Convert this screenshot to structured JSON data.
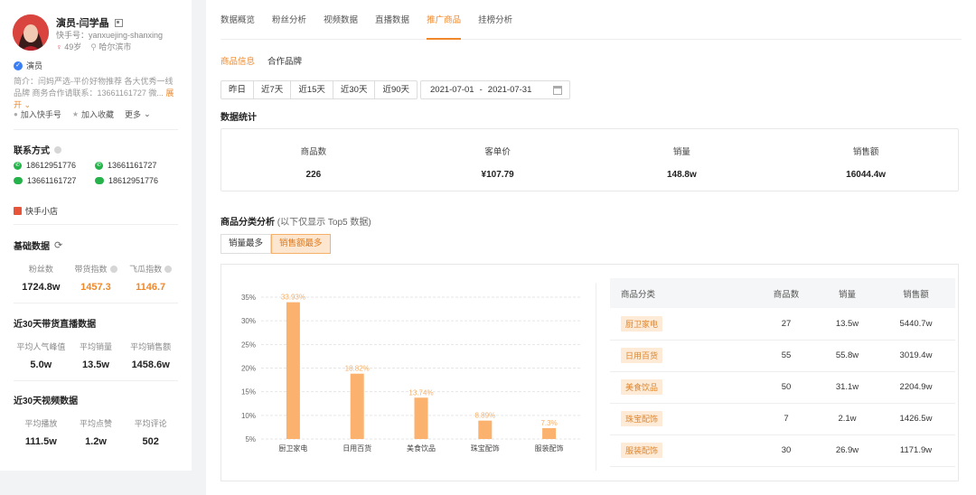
{
  "profile": {
    "name": "演员-闫学晶",
    "kuaishou_id": "快手号：yanxuejing-shanxing",
    "age": "49岁",
    "city": "哈尔滨市",
    "role": "演员",
    "intro": "简介：闫妈严选-平价好物推荐 各大优秀一线品牌 商务合作请联系：13661161727 微...",
    "expand": "展开",
    "actions": {
      "add_kuaishou": "加入快手号",
      "add_favorite": "加入收藏",
      "more": "更多"
    }
  },
  "contact": {
    "title": "联系方式",
    "items": [
      {
        "type": "phone",
        "value": "18612951776"
      },
      {
        "type": "phone",
        "value": "13661161727"
      },
      {
        "type": "wechat",
        "value": "13661161727"
      },
      {
        "type": "wechat",
        "value": "18612951776"
      }
    ],
    "shop": "快手小店"
  },
  "basic": {
    "title": "基础数据",
    "stats": [
      {
        "label": "粉丝数",
        "value": "1724.8w"
      },
      {
        "label": "带货指数",
        "value": "1457.3"
      },
      {
        "label": "飞瓜指数",
        "value": "1146.7"
      }
    ]
  },
  "live30": {
    "title": "近30天带货直播数据",
    "stats": [
      {
        "label": "平均人气峰值",
        "value": "5.0w"
      },
      {
        "label": "平均销量",
        "value": "13.5w"
      },
      {
        "label": "平均销售额",
        "value": "1458.6w"
      }
    ]
  },
  "video30": {
    "title": "近30天视频数据",
    "stats": [
      {
        "label": "平均播放",
        "value": "111.5w"
      },
      {
        "label": "平均点赞",
        "value": "1.2w"
      },
      {
        "label": "平均评论",
        "value": "502"
      }
    ]
  },
  "tabs": [
    "数据概览",
    "粉丝分析",
    "视频数据",
    "直播数据",
    "推广商品",
    "挂榜分析"
  ],
  "active_tab": "推广商品",
  "subtabs": [
    "商品信息",
    "合作品牌"
  ],
  "ranges": [
    "昨日",
    "近7天",
    "近15天",
    "近30天",
    "近90天"
  ],
  "date": {
    "start": "2021-07-01",
    "sep": "-",
    "end": "2021-07-31"
  },
  "summary": {
    "title": "数据统计",
    "items": [
      {
        "label": "商品数",
        "value": "226"
      },
      {
        "label": "客单价",
        "value": "¥107.79"
      },
      {
        "label": "销量",
        "value": "148.8w"
      },
      {
        "label": "销售额",
        "value": "16044.4w"
      }
    ]
  },
  "category": {
    "title": "商品分类分析",
    "note": "(以下仅显示 Top5 数据)",
    "toggles": [
      "销量最多",
      "销售额最多"
    ],
    "table": {
      "headers": [
        "商品分类",
        "商品数",
        "销量",
        "销售额"
      ],
      "rows": [
        [
          "厨卫家电",
          "27",
          "13.5w",
          "5440.7w"
        ],
        [
          "日用百货",
          "55",
          "55.8w",
          "3019.4w"
        ],
        [
          "美食饮品",
          "50",
          "31.1w",
          "2204.9w"
        ],
        [
          "珠宝配饰",
          "7",
          "2.1w",
          "1426.5w"
        ],
        [
          "服装配饰",
          "30",
          "26.9w",
          "1171.9w"
        ]
      ]
    }
  },
  "colors": {
    "accent": "#f0882b",
    "bar": "#fbb26e",
    "bar_label": "#f5b06a"
  },
  "chart_data": {
    "type": "bar",
    "categories": [
      "厨卫家电",
      "日用百货",
      "美食饮品",
      "珠宝配饰",
      "服装配饰"
    ],
    "values": [
      33.93,
      18.82,
      13.74,
      8.89,
      7.3
    ],
    "value_labels": [
      "33.93%",
      "18.82%",
      "13.74%",
      "8.89%",
      "7.3%"
    ],
    "y_ticks": [
      "5%",
      "10%",
      "15%",
      "20%",
      "25%",
      "30%",
      "35%"
    ],
    "ylim": [
      5,
      35
    ],
    "grid": true
  }
}
